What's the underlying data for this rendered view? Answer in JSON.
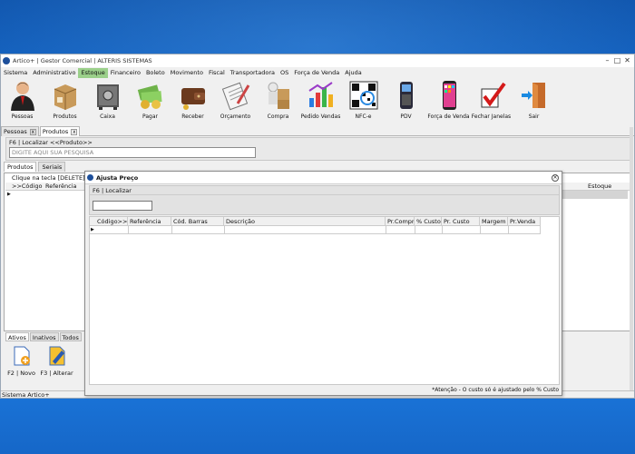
{
  "window": {
    "title": "Artico+ | Gestor Comercial | ALTERIS SISTEMAS",
    "minimize": "–",
    "maximize": "□",
    "close": "✕"
  },
  "menu": [
    "Sistema",
    "Administrativo",
    "Estoque",
    "Financeiro",
    "Boleto",
    "Movimento",
    "Fiscal",
    "Transportadora",
    "OS",
    "Força de Venda",
    "Ajuda"
  ],
  "menu_active": "Estoque",
  "toolbar": [
    {
      "label": "Pessoas",
      "icon": "person-icon"
    },
    {
      "label": "Produtos",
      "icon": "box-icon"
    },
    {
      "label": "Caixa",
      "icon": "safe-icon"
    },
    {
      "label": "Pagar",
      "icon": "money-icon"
    },
    {
      "label": "Receber",
      "icon": "wallet-icon"
    },
    {
      "label": "Orçamento",
      "icon": "clipboard-icon"
    },
    {
      "label": "Compra",
      "icon": "delivery-icon"
    },
    {
      "label": "Pedido Vendas",
      "icon": "chart-icon"
    },
    {
      "label": "NFC-e",
      "icon": "qrcode-icon"
    },
    {
      "label": "PDV",
      "icon": "pos-terminal-icon"
    },
    {
      "label": "Força de Venda",
      "icon": "smartphone-icon"
    },
    {
      "label": "Fechar Janelas",
      "icon": "checkmark-icon"
    },
    {
      "label": "Sair",
      "icon": "exit-door-icon"
    }
  ],
  "doc_tabs": [
    {
      "label": "Pessoas",
      "close": "x"
    },
    {
      "label": "Produtos",
      "close": "x"
    }
  ],
  "search": {
    "label": "F6 | Localizar <<Produto>>",
    "placeholder": "DIGITE AQUI SUA PESQUISA"
  },
  "inner_tabs": [
    "Produtos",
    "Seriais"
  ],
  "grid": {
    "hint": "Clique na tecla [DELETE] para",
    "headers": [
      ">>Código",
      "Referência",
      "Estoque"
    ],
    "row_marker": "▶"
  },
  "status_filter_tabs": [
    "Ativos",
    "Inativos",
    "Todos"
  ],
  "bottom_actions": [
    {
      "label": "F2 | Novo",
      "icon": "new-document-icon"
    },
    {
      "label": "F3 | Alterar",
      "icon": "edit-document-icon"
    }
  ],
  "status_bar": "Sistema Artico+",
  "modal": {
    "title": "Ajusta Preço",
    "close": "×",
    "search_label": "F6 | Localizar",
    "columns": [
      "Código>>",
      "Referência",
      "Cód. Barras",
      "Descrição",
      "Pr.Compra",
      "% Custo",
      "Pr. Custo",
      "Margem",
      "Pr.Venda"
    ],
    "row_marker": "▶",
    "footer": "*Atenção - O custo só é ajustado pelo % Custo"
  }
}
